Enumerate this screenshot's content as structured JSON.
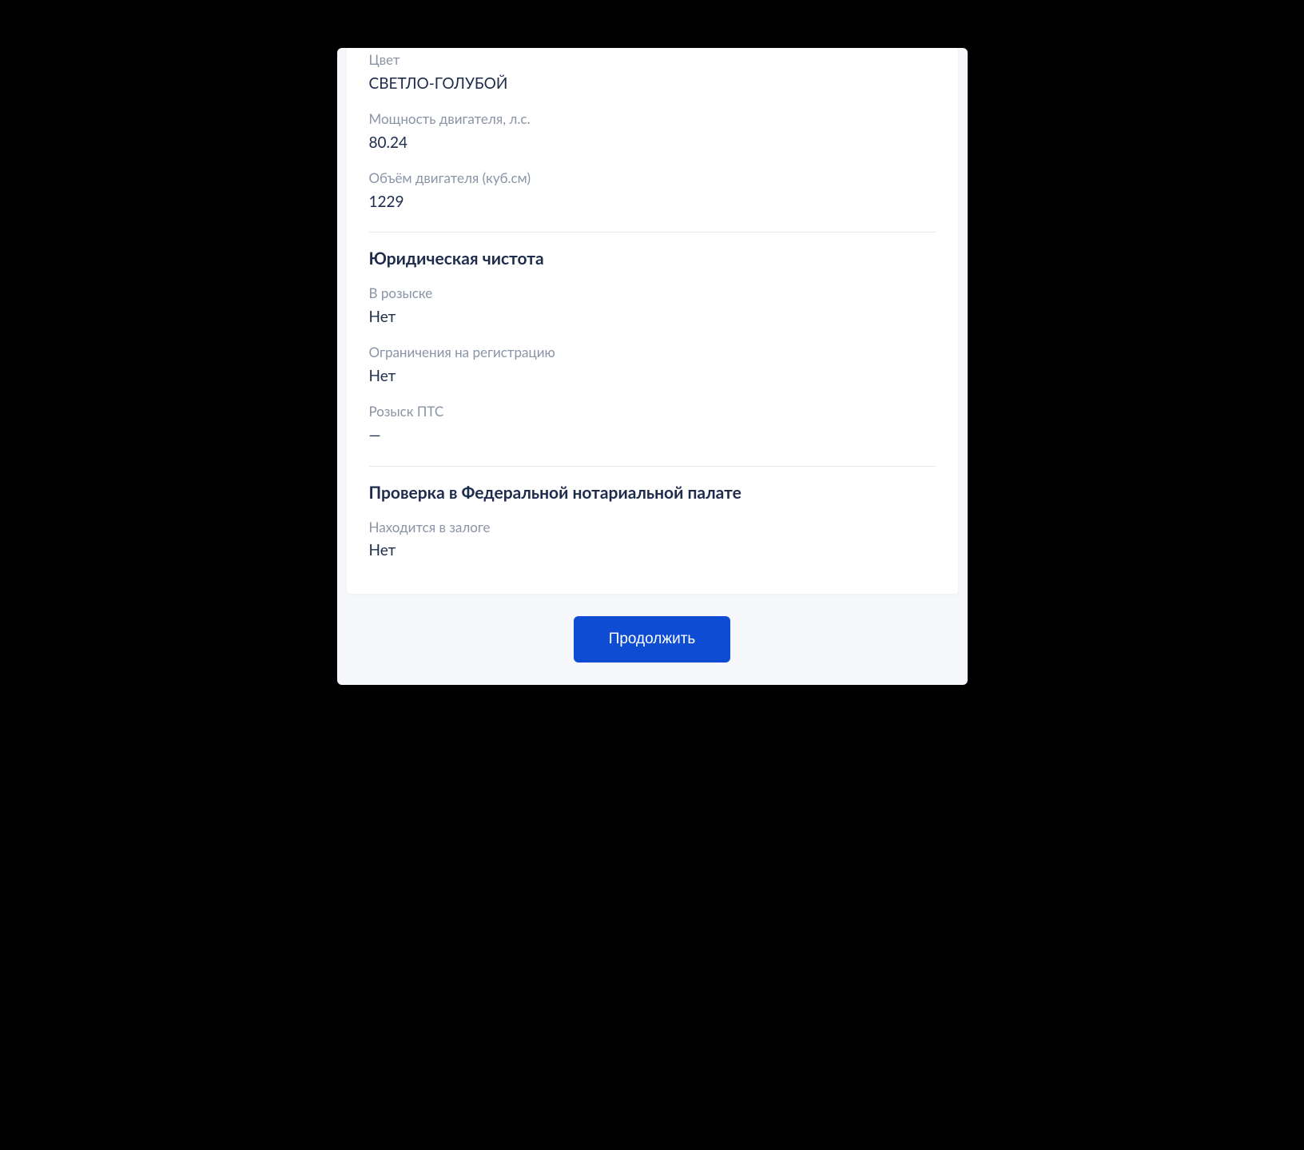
{
  "vehicle": {
    "color": {
      "label": "Цвет",
      "value": "СВЕТЛО-ГОЛУБОЙ"
    },
    "engine_power": {
      "label": "Мощность двигателя, л.с.",
      "value": "80.24"
    },
    "engine_volume": {
      "label": "Объём двигателя (куб.см)",
      "value": "1229"
    }
  },
  "legal": {
    "title": "Юридическая чистота",
    "wanted": {
      "label": "В розыске",
      "value": "Нет"
    },
    "restrictions": {
      "label": "Ограничения на регистрацию",
      "value": "Нет"
    },
    "pts_search": {
      "label": "Розыск ПТС",
      "value": "—"
    }
  },
  "notary": {
    "title": "Проверка в Федеральной нотариальной палате",
    "pledge": {
      "label": "Находится в залоге",
      "value": "Нет"
    }
  },
  "actions": {
    "continue_label": "Продолжить"
  }
}
